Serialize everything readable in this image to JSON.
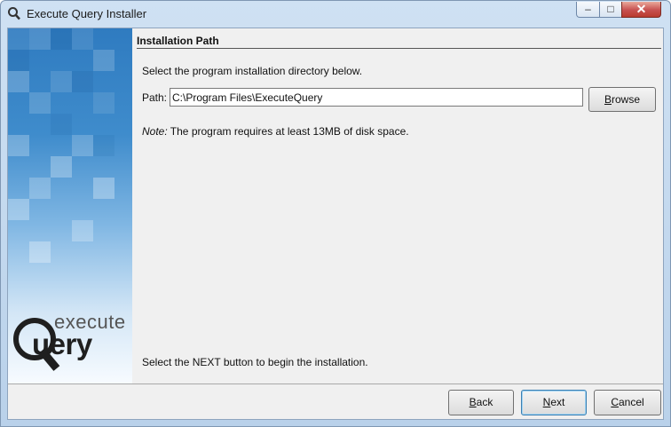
{
  "window": {
    "title": "Execute Query Installer",
    "controls": {
      "minimize": "–",
      "maximize": "□",
      "close": "✕"
    }
  },
  "sidebar": {
    "logo_top": "execute",
    "logo_bottom": "uery"
  },
  "content": {
    "section_title": "Installation Path",
    "intro": "Select the program installation directory below.",
    "path_label": "Path:",
    "path_value": "C:\\Program Files\\ExecuteQuery",
    "browse_mnemonic": "B",
    "browse_rest": "rowse",
    "note_label": "Note:",
    "note_text": " The program requires at least 13MB of disk space.",
    "footer_message": "Select the NEXT button to begin the installation."
  },
  "buttons": {
    "back_mnemonic": "B",
    "back_rest": "ack",
    "next_mnemonic": "N",
    "next_rest": "ext",
    "cancel_mnemonic": "C",
    "cancel_rest": "ancel"
  },
  "colors": {
    "titlebar": "#c9dcf0",
    "sidebar_top": "#2f7bc0",
    "client_bg": "#f0f0f0"
  },
  "icons": {
    "app": "magnifier-icon"
  }
}
